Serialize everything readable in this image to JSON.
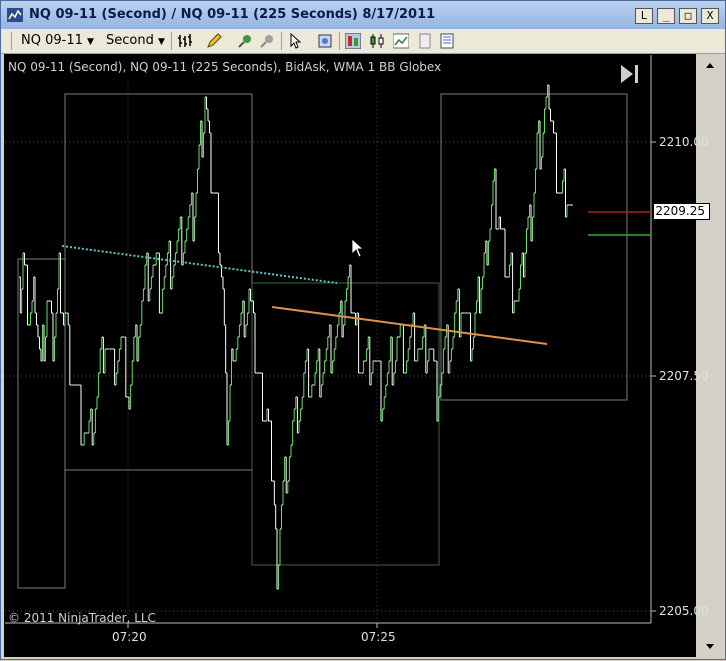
{
  "window": {
    "title": "NQ 09-11 (Second) / NQ 09-11 (225 Seconds)  8/17/2011",
    "buttons": [
      "L",
      "_",
      "□",
      "X"
    ]
  },
  "toolbar": {
    "instrument": "NQ 09-11",
    "interval": "Second"
  },
  "chart": {
    "title": "NQ 09-11 (Second), NQ 09-11 (225 Seconds), BidAsk, WMA 1 BB Globex",
    "copyright": "© 2011 NinjaTrader, LLC",
    "price_tag": "2209.25",
    "price_tag_value": 2209.25,
    "y_ticks": [
      {
        "value": 2210.0,
        "label": "2210.00"
      },
      {
        "value": 2207.5,
        "label": "2207.50"
      },
      {
        "value": 2205.0,
        "label": "2205.00"
      }
    ],
    "x_ticks": [
      {
        "label": "07:20"
      },
      {
        "label": "07:25"
      }
    ],
    "colors": {
      "background": "#000000",
      "price_line": "#ffffff",
      "up_tick": "#66dd66",
      "box_border": "#7a7a7a",
      "dotted_trend": "#5fc8c8",
      "solid_trend": "#e0924a",
      "ask_line": "#aa2222",
      "bid_line": "#33aa33"
    }
  }
}
